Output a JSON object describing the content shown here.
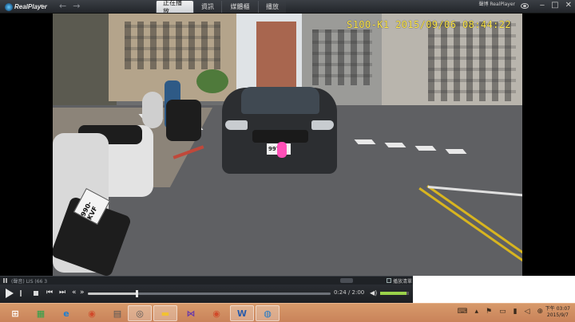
{
  "titlebar": {
    "app_name": "RealPlayer",
    "tabs": [
      {
        "label": "正在播放",
        "active": true
      },
      {
        "label": "資訊",
        "active": false
      },
      {
        "label": "媒體櫃",
        "active": false
      },
      {
        "label": "播放",
        "active": false
      }
    ],
    "brand_right_line1": "聲博 RealPlayer",
    "icons": [
      "eye-icon",
      "minimize-icon",
      "restore-icon",
      "close-icon"
    ]
  },
  "video": {
    "timestamp": "S100-K1 2015/09/06 08:44:22",
    "plate_car": "997",
    "plate_scooter": "990-KVF"
  },
  "infobar": {
    "title": "(聲音) LIS (66 3",
    "playlist_label": "播放清單"
  },
  "controls": {
    "time": "0:24 / 2:00",
    "progress_fraction": 0.2,
    "volume_fraction": 0.92
  },
  "taskbar": {
    "icons": [
      "windows-start-icon",
      "store-icon",
      "ie-icon",
      "chrome-icon",
      "files-icon",
      "realplayer-icon",
      "folder-icon",
      "visual-studio-icon",
      "chrome-icon-2",
      "word-icon",
      "realplayer-icon-2"
    ],
    "clock_time": "下午 03:07",
    "clock_date": "2015/9/7"
  },
  "colors": {
    "timestamp": "#ffe84a",
    "taskbar": "#cf8b60",
    "plate_blur": "#ff4fb7"
  }
}
